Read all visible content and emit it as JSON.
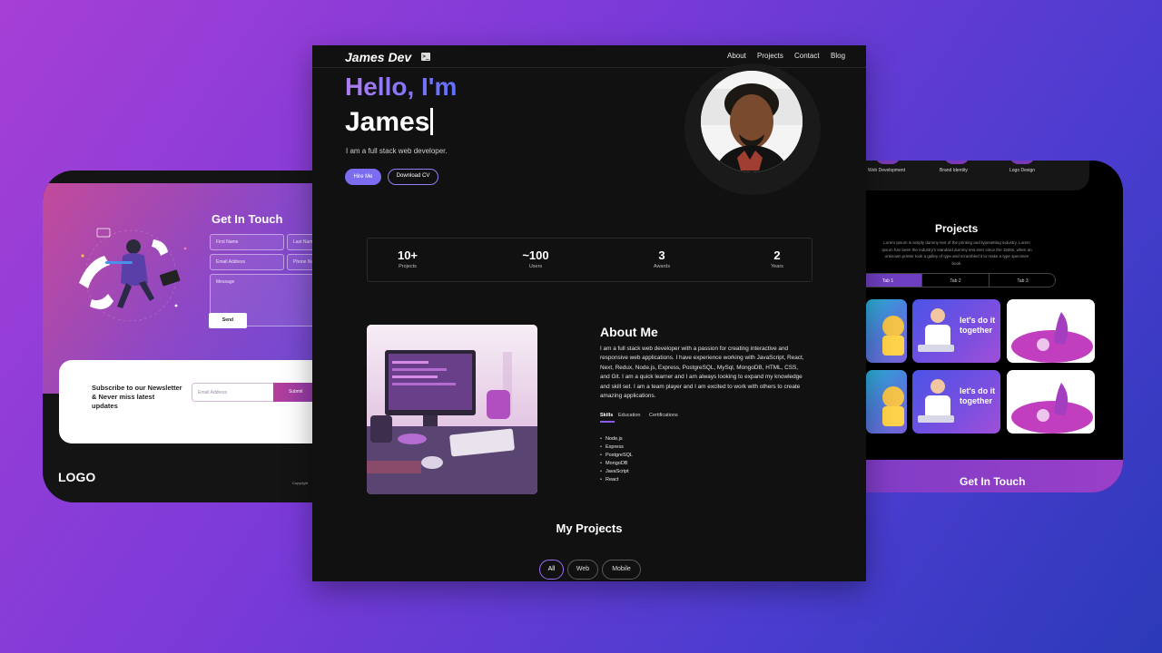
{
  "left_card": {
    "title": "Get In Touch",
    "fields": {
      "first_name": "First Name",
      "last_name": "Last Name",
      "email": "Email Address",
      "phone": "Phone Number",
      "message": "Message"
    },
    "send_label": "Send",
    "newsletter_text": "Subscribe to our Newsletter & Never miss latest updates",
    "newsletter_placeholder": "Email Address",
    "newsletter_submit": "Submit",
    "logo": "LOGO",
    "copyright": "Copyright"
  },
  "right_card": {
    "services": [
      "Web Development",
      "Brand Identity",
      "Logo Design"
    ],
    "projects_title": "Projects",
    "projects_desc": "Lorem Ipsum is simply dummy text of the printing and typesetting industry. Lorem Ipsum has been the industry's standard dummy text ever since the 1500s, when an unknown printer took a galley of type and scrambled it to make a type specimen book.",
    "tabs": [
      "Tab 1",
      "Tab 2",
      "Tab 3"
    ],
    "active_tab": "Tab 1",
    "thumb_text": "let's do it together",
    "get_in_touch": "Get In Touch"
  },
  "main": {
    "brand": "James Dev",
    "nav_links": [
      "About",
      "Projects",
      "Contact",
      "Blog"
    ],
    "hello": "Hello, I'm",
    "name": "James",
    "tagline": "I am a full stack web developer.",
    "hire_label": "Hire Me",
    "cv_label": "Download CV",
    "stats": [
      {
        "value": "10+",
        "label": "Projects"
      },
      {
        "value": "~100",
        "label": "Users"
      },
      {
        "value": "3",
        "label": "Awards"
      },
      {
        "value": "2",
        "label": "Years"
      }
    ],
    "about_title": "About Me",
    "about_text": "I am a full stack web developer with a passion for creating interactive and responsive web applications. I have experience working with JavaScript, React, Next, Redux, Node.js, Express, PostgreSQL, MySql, MongoDB, HTML, CSS, and Git. I am a quick learner and I am always looking to expand my knowledge and skill set. I am a team player and I am excited to work with others to create amazing applications.",
    "about_tabs": [
      "Skills",
      "Education",
      "Certifications"
    ],
    "active_about_tab": "Skills",
    "skills": [
      "Node.js",
      "Express",
      "PostgreSQL",
      "MongoDB",
      "JavaScript",
      "React"
    ],
    "projects_title": "My Projects",
    "filters": [
      "All",
      "Web",
      "Mobile"
    ],
    "active_filter": "All"
  },
  "colors": {
    "accent": "#7b6cf0",
    "background_gradient_start": "#a63fd6",
    "background_gradient_end": "#2b3ab8"
  }
}
